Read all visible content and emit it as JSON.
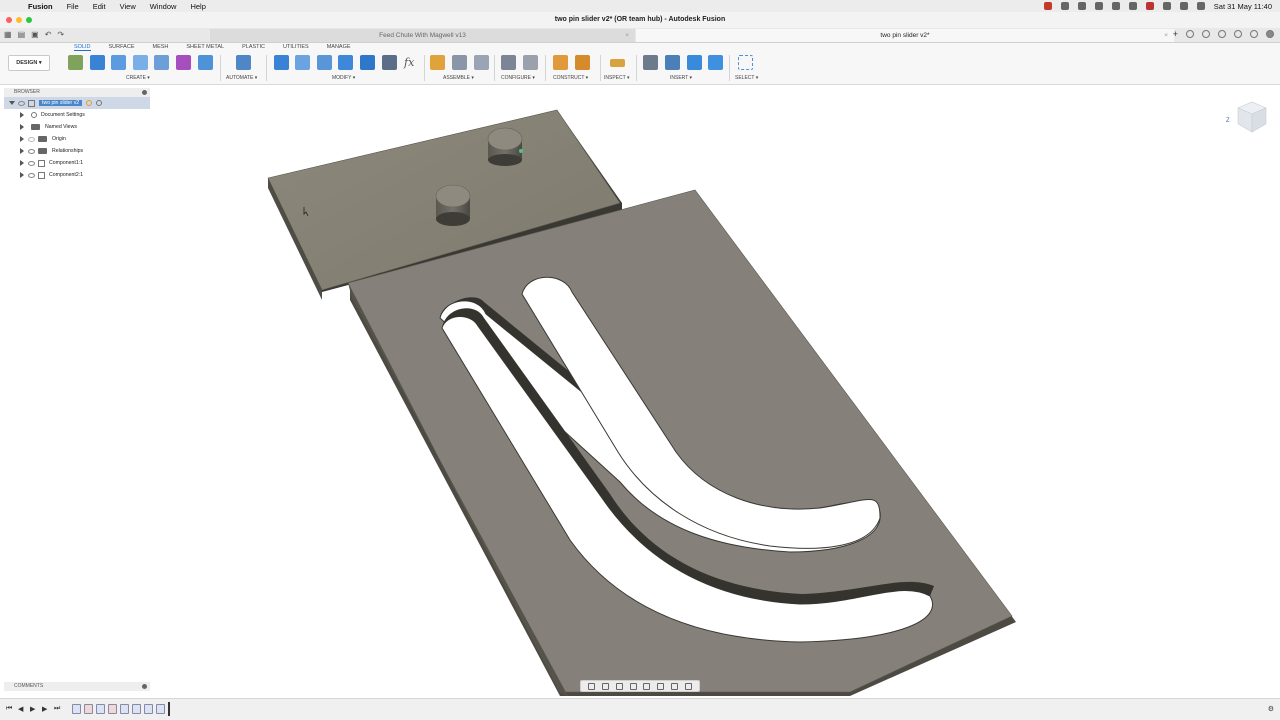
{
  "mac_menu": {
    "app": "Fusion",
    "items": [
      "File",
      "Edit",
      "View",
      "Window",
      "Help"
    ],
    "clock": "Sat 31 May  11:40"
  },
  "window": {
    "title": "two pin slider v2* (OR team hub) - Autodesk Fusion"
  },
  "tabs": [
    {
      "label": "Feed Chute With Magwell v13"
    },
    {
      "label": "two pin slider v2*"
    }
  ],
  "ribbon": {
    "workspace": "DESIGN ▾",
    "tabs": [
      "SOLID",
      "SURFACE",
      "MESH",
      "SHEET METAL",
      "PLASTIC",
      "UTILITIES",
      "MANAGE"
    ],
    "groups": {
      "create": "CREATE ▾",
      "automate": "AUTOMATE ▾",
      "modify": "MODIFY ▾",
      "assemble": "ASSEMBLE ▾",
      "configure": "CONFIGURE ▾",
      "construct": "CONSTRUCT ▾",
      "inspect": "INSPECT ▾",
      "insert": "INSERT ▾",
      "select": "SELECT ▾"
    },
    "fx": "fx"
  },
  "browser": {
    "header": "BROWSER",
    "root": "two pin slider v2",
    "items": [
      "Document Settings",
      "Named Views",
      "Origin",
      "Relationships",
      "Component1:1",
      "Component2:1"
    ]
  },
  "comments": {
    "header": "COMMENTS"
  },
  "viewcube": {
    "label": "Z"
  },
  "colors": {
    "accent": "#1b6fd0",
    "part_top": "#8a8679",
    "part_side": "#55524a",
    "selection": "#4a86c8"
  }
}
